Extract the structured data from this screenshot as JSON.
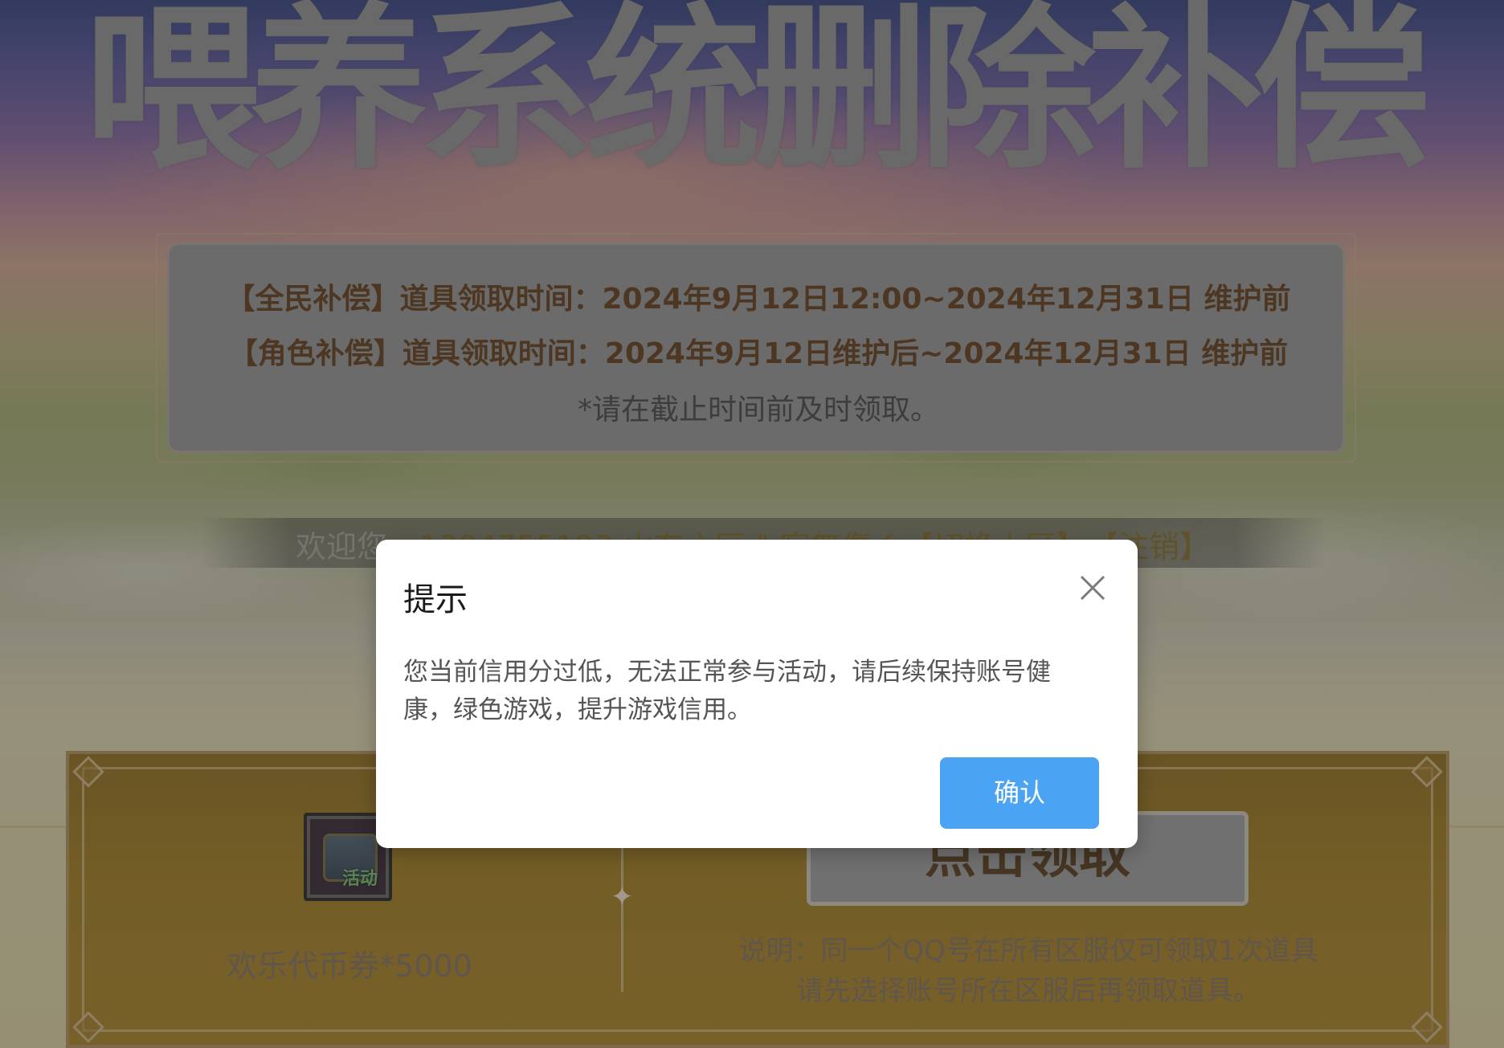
{
  "page": {
    "title": "喂养系统删除补偿"
  },
  "info": {
    "line1": "【全民补偿】道具领取时间：2024年9月12日12:00~2024年12月31日 维护前",
    "line2": "【角色补偿】道具领取时间：2024年9月12日维护后~2024年12月31日 维护前",
    "line3": "*请在截止时间前及时领取。"
  },
  "welcome": {
    "prefix": "欢迎您，",
    "user": "1394755193 山东六区 ‖ 寂無傷ぐ",
    "switch_label": "【切换大区】",
    "logout_label": "【注销】"
  },
  "reward": {
    "icon_tag": "活动",
    "item_label": "欢乐代币券*5000",
    "claim_label": "点击领取",
    "note1": "说明：同一个QQ号在所有区服仅可领取1次道具",
    "note2": "请先选择账号所在区服后再领取道具。"
  },
  "modal": {
    "title": "提示",
    "message": "您当前信用分过低，无法正常参与活动，请后续保持账号健康，绿色游戏，提升游戏信用。",
    "ok_label": "确认"
  },
  "colors": {
    "accent": "#4aa3f3",
    "info_text": "#5b3510",
    "gold_panel": "#9c7618"
  },
  "icons": {
    "close": "close-icon",
    "star": "sparkle-icon",
    "chest": "treasure-chest-icon"
  }
}
